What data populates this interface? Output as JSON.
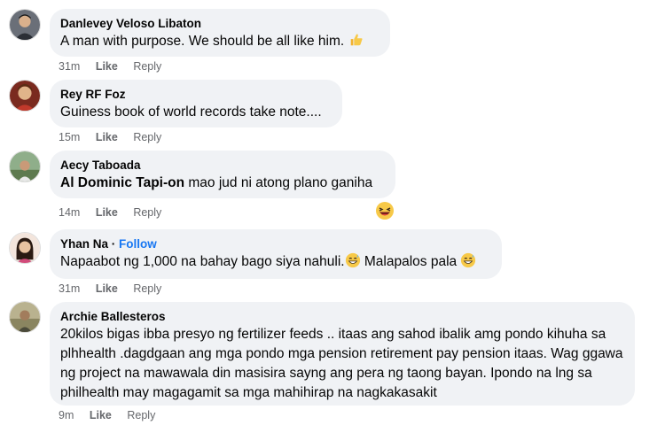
{
  "comments": [
    {
      "author": "Danlevey Veloso Libaton",
      "text": "A man with purpose. We should be all like him.",
      "text_emoji": "thumbs-up-icon",
      "time": "31m",
      "like": "Like",
      "reply": "Reply"
    },
    {
      "author": "Rey RF Foz",
      "text": "Guiness book of world records take note....",
      "time": "15m",
      "like": "Like",
      "reply": "Reply"
    },
    {
      "author": "Aecy Taboada",
      "mention": "Al Dominic Tapi-on",
      "text": " mao jud ni atong plano ganiha",
      "time": "14m",
      "like": "Like",
      "reply": "Reply",
      "reaction_emoji": "laughing-face-icon"
    },
    {
      "author": "Yhan Na",
      "separator": "·",
      "follow": "Follow",
      "text_part1": "Napaabot ng 1,000 na bahay bago siya nahuli.",
      "text_part2": " Malapalos pala",
      "time": "31m",
      "like": "Like",
      "reply": "Reply"
    },
    {
      "author": "Archie Ballesteros",
      "text": "20kilos bigas ibba presyo ng fertilizer feeds .. itaas ang sahod ibalik amg pondo kihuha sa plhhealth .dagdgaan ang mga pondo mga pension retirement pay pension itaas. Wag ggawa ng project na mawawala din masisira sayng ang pera ng taong bayan. Ipondo na lng sa philhealth may magagamit sa mga mahihirap na nagkakasakit",
      "time": "9m",
      "like": "Like",
      "reply": "Reply"
    }
  ],
  "colors": {
    "bubble": "#f0f2f5",
    "meta": "#65676b",
    "follow": "#1877f2"
  }
}
